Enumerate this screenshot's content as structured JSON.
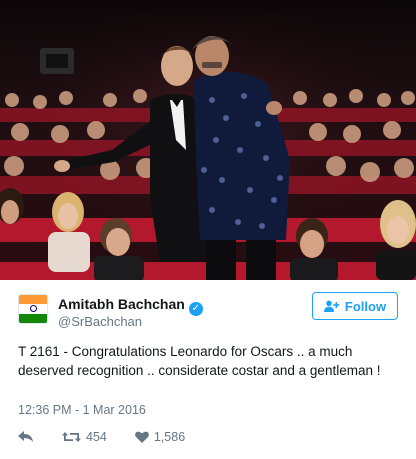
{
  "tweet": {
    "display_name": "Amitabh Bachchan",
    "verified_glyph": "✓",
    "handle": "@SrBachchan",
    "follow_label": "Follow",
    "text": "T 2161 - Congratulations Leonardo for Oscars .. a much deserved recognition .. considerate costar and a gentleman !",
    "timestamp": "12:36 PM - 1 Mar 2016",
    "retweet_count": "454",
    "like_count": "1,586"
  },
  "icons": {
    "avatar": "india-flag-avatar",
    "verified": "verified-badge-icon",
    "follow": "add-user-icon",
    "reply": "reply-icon",
    "retweet": "retweet-icon",
    "like": "heart-icon"
  },
  "colors": {
    "twitter_blue": "#1da1f2",
    "text_primary": "#14171a",
    "text_secondary": "#657786",
    "seat_red": "#b3182c",
    "theater_dark": "#150a0c"
  }
}
